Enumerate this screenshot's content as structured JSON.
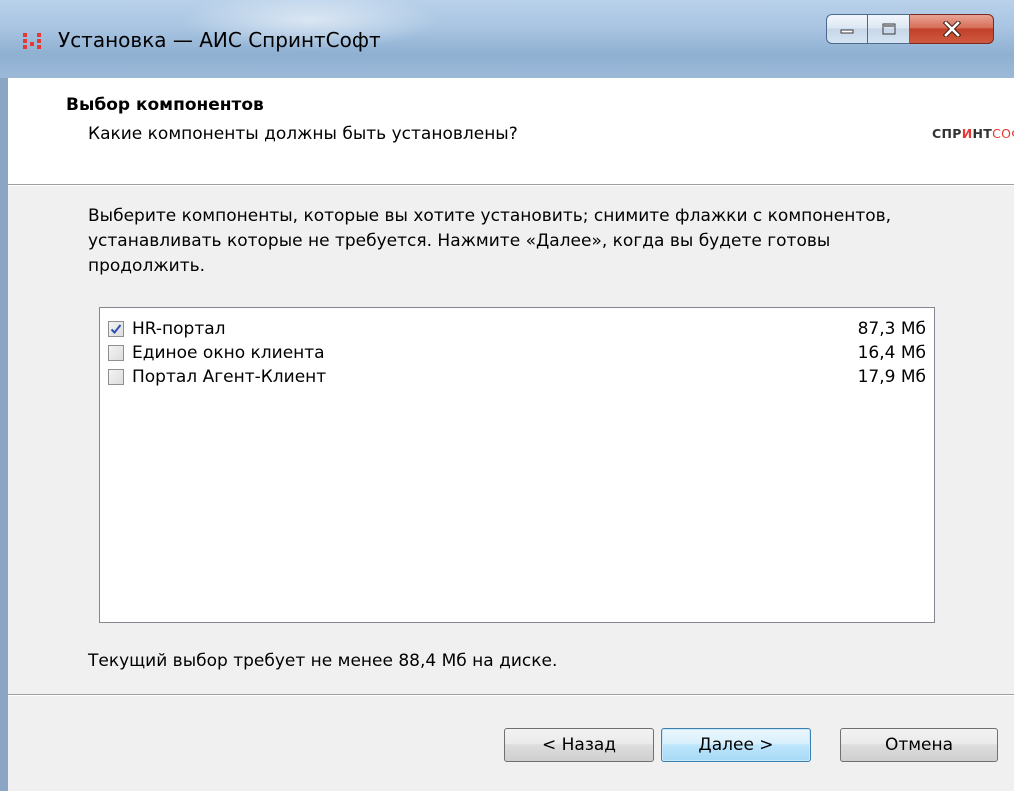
{
  "window": {
    "title": "Установка — АИС СпринтСофт"
  },
  "header": {
    "title": "Выбор компонентов",
    "subtitle": "Какие компоненты должны быть установлены?",
    "logo": {
      "part1": "СПР",
      "part2": "И",
      "part3": "НТ",
      "part4": "СОФТ"
    }
  },
  "main": {
    "description": "Выберите компоненты, которые вы хотите установить; снимите флажки с компонентов, устанавливать которые не требуется. Нажмите «Далее», когда вы будете готовы продолжить.",
    "components": [
      {
        "label": "HR-портал",
        "size": "87,3 Мб",
        "checked": true
      },
      {
        "label": "Единое окно клиента",
        "size": "16,4 Мб",
        "checked": false
      },
      {
        "label": "Портал Агент-Клиент",
        "size": "17,9 Мб",
        "checked": false
      }
    ],
    "requirement": "Текущий выбор требует не менее 88,4 Мб на диске."
  },
  "buttons": {
    "back": "< Назад",
    "next": "Далее >",
    "cancel": "Отмена"
  },
  "colors": {
    "accent": "#e53935",
    "default_button_border": "#3c7fb1",
    "close_button": "#c2402a"
  }
}
